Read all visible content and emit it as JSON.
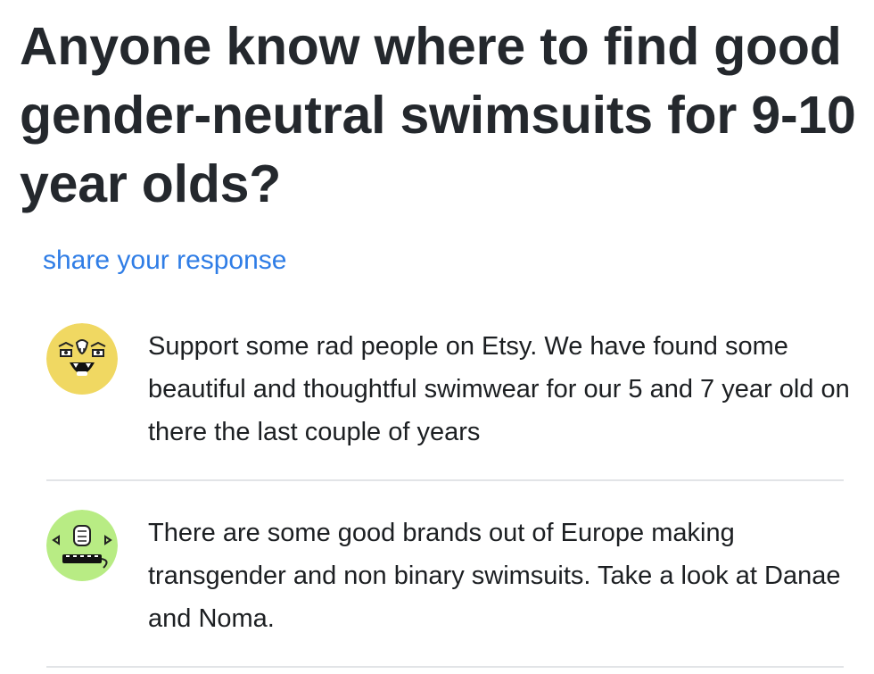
{
  "question": {
    "title": "Anyone know where to find good gender-neutral swimsuits for 9-10 year olds?"
  },
  "share_link": {
    "label": "share your response",
    "color": "#2f7de6"
  },
  "responses": [
    {
      "avatar_icon": "monster-face-avatar-yellow",
      "avatar_color": "#f0d862",
      "text": "Support some rad people on Etsy.  We have found some beautiful and thoughtful swimwear for our 5 and 7 year old on there the last couple of years"
    },
    {
      "avatar_icon": "monster-face-avatar-green",
      "avatar_color": "#b8ec84",
      "text": "There are some good brands out of Europe making transgender and non binary swimsuits.  Take a look at Danae and Noma."
    }
  ]
}
